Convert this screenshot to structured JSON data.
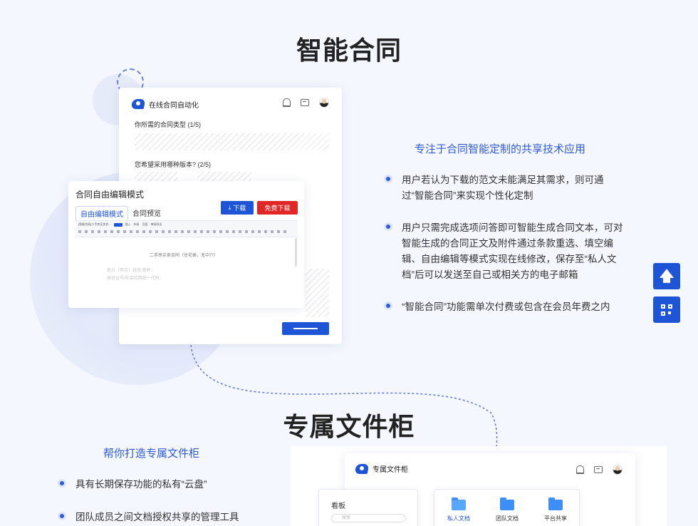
{
  "section1": {
    "title": "智能合同",
    "mock_app": {
      "name": "在线合同自动化",
      "question1": "你所需的合同类型 (1/5)",
      "question2": "您希望采用哪种版本? (2/5)"
    },
    "editor": {
      "title": "合同自由编辑模式",
      "tabs": [
        "自由编辑模式",
        "合同预览"
      ],
      "download_label": "下载",
      "free_download_label": "免费下载",
      "doc_filename": "[智能合同]二手房买卖合...",
      "toolbar_tabs": [
        "开始",
        "插入",
        "布局",
        "页面",
        "审阅导出"
      ],
      "doc_heading": "二手房买卖合同（住宅类，无中介）",
      "doc_line1": "卖方（甲方）姓名/名称：",
      "doc_line2": "身份证号/社会信用统一代码："
    },
    "feature_title": "专注于合同智能定制的共享技术应用",
    "bullets": [
      [
        "用户若认为下载的范文未能满足其需求，则可通",
        "过“智能合同”来实现个性化定制"
      ],
      [
        "用户只需完成选项问答即可智能生成合同文本，可对",
        "智能生成的合同正文及附件通过条款重选、填空编",
        "辑、自由编辑等模式实现在线修改，保存至“私人文",
        "档”后可以发送至自己或相关方的电子邮箱"
      ],
      [
        "“智能合同”功能需单次付费或包含在会员年费之内"
      ]
    ]
  },
  "section2": {
    "title": "专属文件柜",
    "feature_title": "帮你打造专属文件柜",
    "bullets": [
      "具有长期保存功能的私有“云盘”",
      "团队成员之间文档授权共享的管理工具"
    ],
    "mock_app": {
      "name": "专属文件柜",
      "board_label": "看板",
      "search_placeholder": "搜索",
      "folders": [
        "私人文档",
        "团队文档",
        "平台共享"
      ]
    }
  },
  "colors": {
    "accent": "#1e54d6",
    "red": "#e12626",
    "feature_blue": "#2f5bd6",
    "folder_blue": "#3d8ef7"
  },
  "side_buttons": {
    "top": "arrow-up-icon",
    "qr": "qr-code-icon"
  }
}
